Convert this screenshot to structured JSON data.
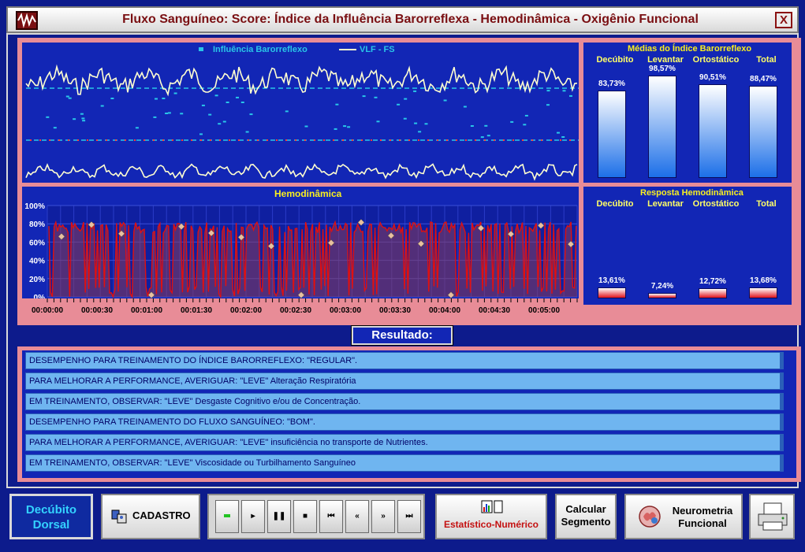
{
  "window": {
    "title": "Fluxo Sanguíneo: Score: Índice da Influência Barorreflexa - Hemodinâmica - Oxigênio Funcional",
    "close_label": "X"
  },
  "signal_chart": {
    "legend": [
      {
        "label": "Influência Barorreflexo",
        "color": "#29c6e8"
      },
      {
        "label": "VLF - FS",
        "color": "#ffffd0"
      }
    ]
  },
  "baro_chart": {
    "title": "Médias do Índice Barorreflexo",
    "columns": [
      "Decúbito",
      "Levantar",
      "Ortostático",
      "Total"
    ],
    "values": [
      83.73,
      98.57,
      90.51,
      88.47
    ],
    "value_labels": [
      "83,73%",
      "98,57%",
      "90,51%",
      "88,47%"
    ]
  },
  "resp_chart": {
    "title": "Resposta Hemodinâmica",
    "columns": [
      "Decúbito",
      "Levantar",
      "Ortostático",
      "Total"
    ],
    "values": [
      13.61,
      7.24,
      12.72,
      13.68
    ],
    "value_labels": [
      "13,61%",
      "7,24%",
      "12,72%",
      "13,68%"
    ]
  },
  "chart_data": {
    "type": "line",
    "title": "Hemodinâmica",
    "ylim": [
      0,
      100
    ],
    "y_tick_labels": [
      "100%",
      "80%",
      "60%",
      "40%",
      "20%",
      "0%"
    ],
    "x_tick_labels": [
      "00:00:00",
      "00:00:30",
      "00:01:00",
      "00:01:30",
      "00:02:00",
      "00:02:30",
      "00:03:00",
      "00:03:30",
      "00:04:00",
      "00:04:30",
      "00:05:00"
    ],
    "grid": true,
    "series_color": "#e01010"
  },
  "result": {
    "header": "Resultado:",
    "rows": [
      "DESEMPENHO PARA TREINAMENTO DO ÍNDICE BARORREFLEXO: \"REGULAR\".",
      "PARA MELHORAR A PERFORMANCE, AVERIGUAR: \"LEVE\" Alteração Respiratória",
      "EM TREINAMENTO, OBSERVAR: \"LEVE\" Desgaste Cognitivo e/ou de Concentração.",
      "DESEMPENHO PARA TREINAMENTO DO FLUXO SANGUÍNEO: \"BOM\".",
      "PARA MELHORAR A PERFORMANCE, AVERIGUAR: \"LEVE\" insuficiência no transporte de Nutrientes.",
      "EM TREINAMENTO, OBSERVAR: \"LEVE\" Viscosidade ou Turbilhamento Sanguíneo"
    ]
  },
  "toolbar": {
    "posture_line1": "Decúbito",
    "posture_line2": "Dorsal",
    "cadastro": "CADASTRO",
    "player_buttons": [
      "record",
      "play",
      "pause",
      "stop",
      "skip-back",
      "rewind",
      "fast-forward",
      "skip-forward"
    ],
    "estatistico": "Estatístico-Numérico",
    "calcular_line1": "Calcular",
    "calcular_line2": "Segmento",
    "neuro_line1": "Neurometria",
    "neuro_line2": "Funcional",
    "icons": {
      "cadastro": "contacts-icon",
      "estatistico": "chart-icon",
      "neuro": "brain-icon",
      "print": "printer-icon"
    }
  }
}
